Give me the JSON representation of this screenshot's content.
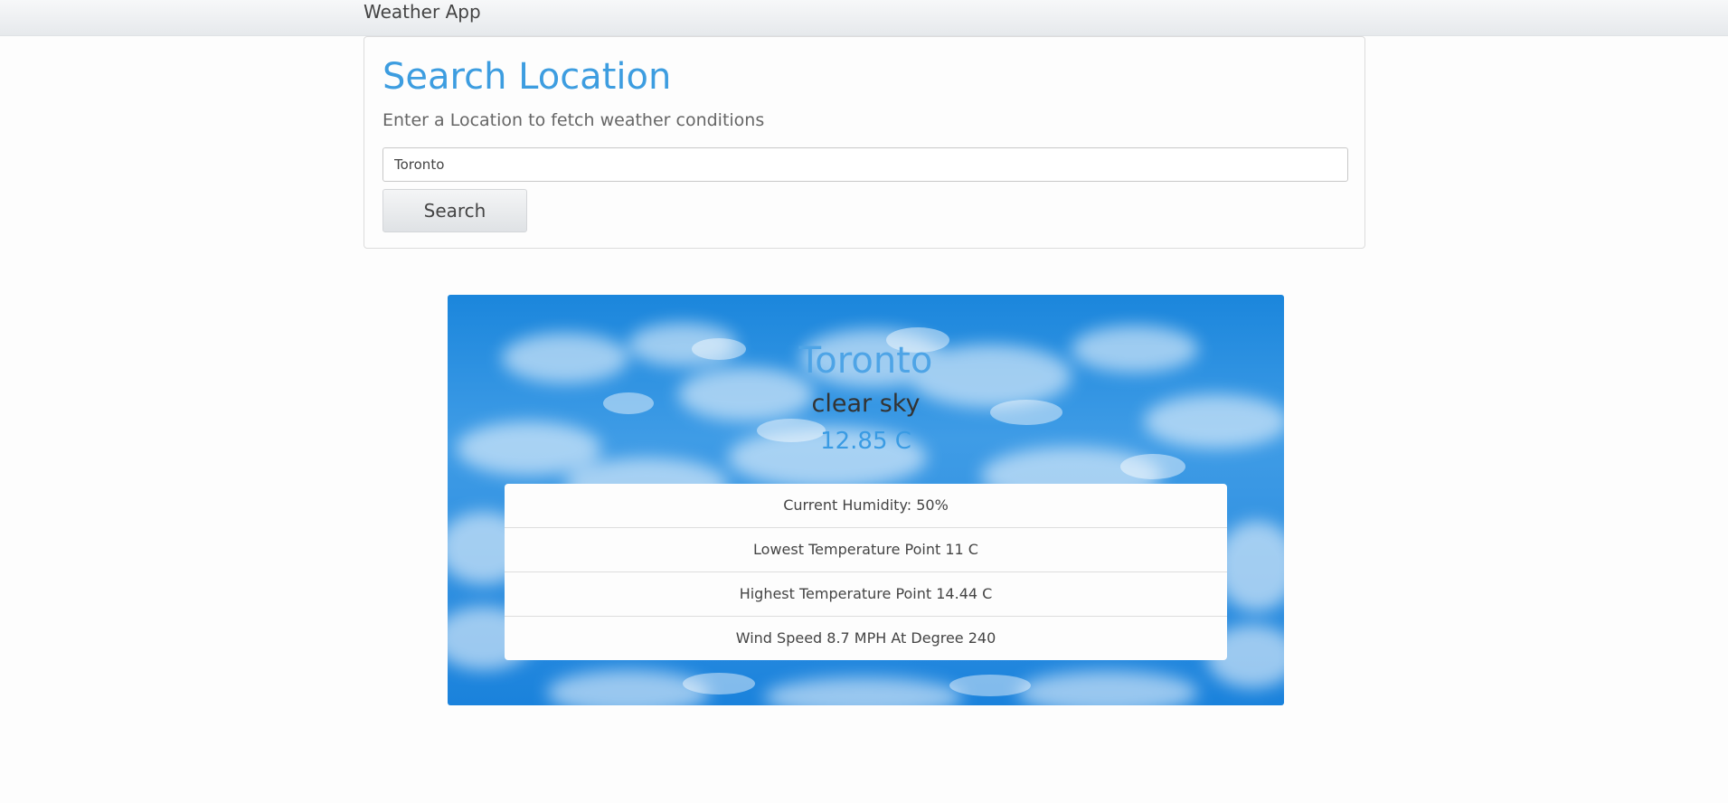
{
  "navbar": {
    "brand": "Weather App"
  },
  "search": {
    "title": "Search Location",
    "subtitle": "Enter a Location to fetch weather conditions",
    "input_value": "Toronto",
    "button_label": "Search"
  },
  "weather": {
    "city": "Toronto",
    "description": "clear sky",
    "temperature": "12.85 C",
    "stats": [
      "Current Humidity: 50%",
      "Lowest Temperature Point 11 C",
      "Highest Temperature Point 14.44 C",
      "Wind Speed 8.7 MPH At Degree 240"
    ]
  },
  "colors": {
    "accent": "#3d9de0",
    "sky": "#2f8fe0"
  }
}
